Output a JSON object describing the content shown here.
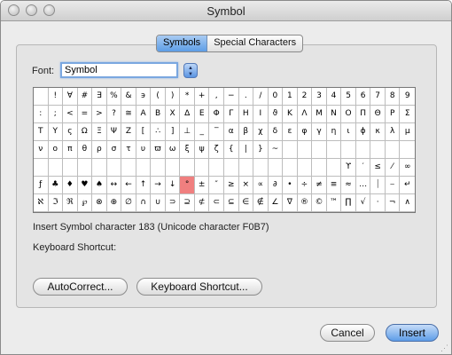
{
  "window": {
    "title": "Symbol"
  },
  "tabs": [
    {
      "label": "Symbols",
      "active": true
    },
    {
      "label": "Special Characters",
      "active": false
    }
  ],
  "font": {
    "label": "Font:",
    "value": "Symbol"
  },
  "grid": {
    "selected_row": 5,
    "selected_col": 10,
    "rows": [
      [
        " ",
        "!",
        "∀",
        "#",
        "∃",
        "%",
        "&",
        "϶",
        "(",
        ")",
        "*",
        "+",
        ",",
        "−",
        ".",
        "/",
        "0",
        "1",
        "2",
        "3",
        "4",
        "5",
        "6",
        "7",
        "8",
        "9"
      ],
      [
        ":",
        ";",
        "<",
        "=",
        ">",
        "?",
        "≅",
        "Α",
        "Β",
        "Χ",
        "Δ",
        "Ε",
        "Φ",
        "Γ",
        "Η",
        "Ι",
        "ϑ",
        "Κ",
        "Λ",
        "Μ",
        "Ν",
        "Ο",
        "Π",
        "Θ",
        "Ρ",
        "Σ"
      ],
      [
        "Τ",
        "Υ",
        "ς",
        "Ω",
        "Ξ",
        "Ψ",
        "Ζ",
        "[",
        "∴",
        "]",
        "⊥",
        "_",
        "‾",
        "α",
        "β",
        "χ",
        "δ",
        "ε",
        "φ",
        "γ",
        "η",
        "ι",
        "ϕ",
        "κ",
        "λ",
        "μ"
      ],
      [
        "ν",
        "ο",
        "π",
        "θ",
        "ρ",
        "σ",
        "τ",
        "υ",
        "ϖ",
        "ω",
        "ξ",
        "ψ",
        "ζ",
        "{",
        "|",
        "}",
        "~",
        "",
        "",
        "",
        "",
        "",
        "",
        "",
        "",
        ""
      ],
      [
        "",
        "",
        "",
        "",
        "",
        "",
        "",
        "",
        "",
        "",
        "",
        "",
        "",
        "",
        "",
        "",
        "",
        "",
        "",
        "",
        "",
        "ϒ",
        "′",
        "≤",
        "⁄",
        "∞"
      ],
      [
        "ƒ",
        "♣",
        "♦",
        "♥",
        "♠",
        "↔",
        "←",
        "↑",
        "→",
        "↓",
        "°",
        "±",
        "″",
        "≥",
        "×",
        "∝",
        "∂",
        "•",
        "÷",
        "≠",
        "≡",
        "≈",
        "…",
        "⏐",
        "⎯",
        "↵"
      ],
      [
        "ℵ",
        "ℑ",
        "ℜ",
        "℘",
        "⊗",
        "⊕",
        "∅",
        "∩",
        "∪",
        "⊃",
        "⊇",
        "⊄",
        "⊂",
        "⊆",
        "∈",
        "∉",
        "∠",
        "∇",
        "®",
        "©",
        "™",
        "∏",
        "√",
        "⋅",
        "¬",
        "∧"
      ]
    ]
  },
  "status": "Insert Symbol character 183  (Unicode character F0B7)",
  "keyboard_shortcut_label": "Keyboard Shortcut:",
  "buttons": {
    "autocorrect": "AutoCorrect...",
    "keyboard_shortcut": "Keyboard Shortcut...",
    "cancel": "Cancel",
    "insert": "Insert"
  },
  "colors": {
    "accent": "#5e9de8",
    "selected_cell": "#f07f7f"
  }
}
